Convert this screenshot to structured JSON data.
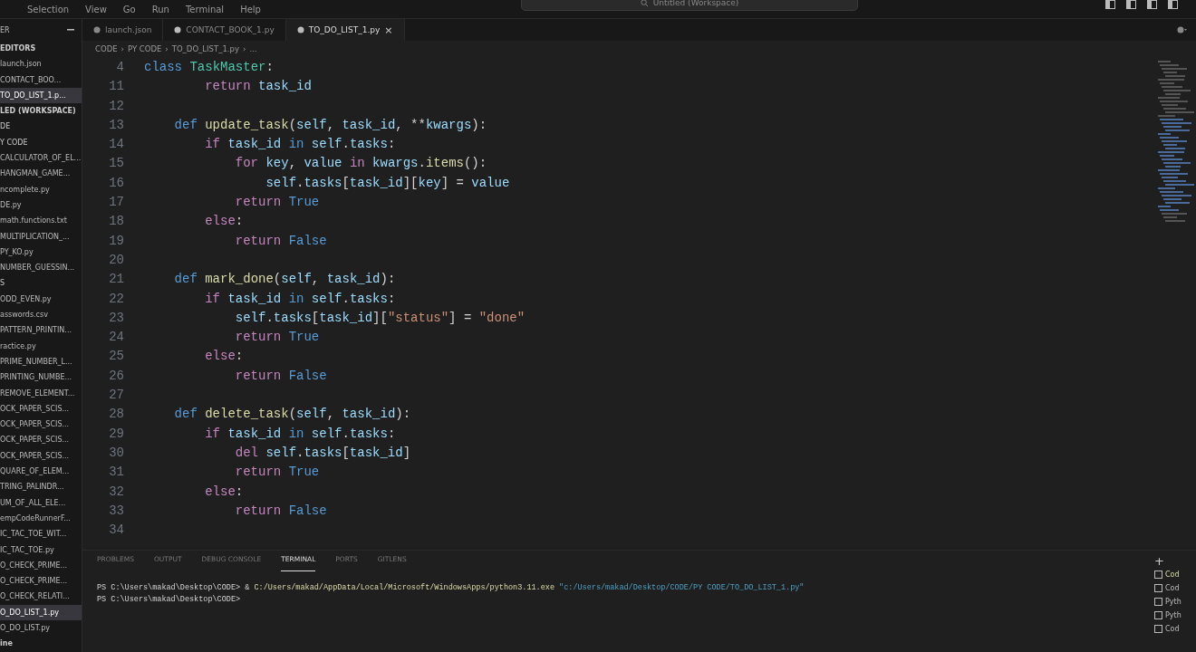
{
  "menu": [
    "Selection",
    "View",
    "Go",
    "Run",
    "Terminal",
    "Help"
  ],
  "command_center": {
    "text": "Untitled (Workspace)"
  },
  "sidebar": {
    "title": "ER",
    "items": [
      {
        "label": "EDITORS",
        "kind": "header",
        "selected": false
      },
      {
        "label": "launch.json",
        "kind": "file",
        "selected": false
      },
      {
        "label": "CONTACT_BOO...",
        "kind": "file",
        "selected": false
      },
      {
        "label": "TO_DO_LIST_1.p...",
        "kind": "file",
        "selected": true
      },
      {
        "label": "LED (WORKSPACE)",
        "kind": "header",
        "selected": false
      },
      {
        "label": "DE",
        "kind": "folder",
        "selected": false
      },
      {
        "label": "Y CODE",
        "kind": "folder",
        "selected": false
      },
      {
        "label": "CALCULATOR_OF_EL...",
        "kind": "file",
        "selected": false
      },
      {
        "label": "HANGMAN_GAME...",
        "kind": "file",
        "selected": false
      },
      {
        "label": "ncomplete.py",
        "kind": "file",
        "selected": false
      },
      {
        "label": "DE.py",
        "kind": "file",
        "selected": false
      },
      {
        "label": "math.functions.txt",
        "kind": "file",
        "selected": false
      },
      {
        "label": "MULTIPLICATION_...",
        "kind": "file",
        "selected": false
      },
      {
        "label": "PY_KO.py",
        "kind": "file",
        "selected": false
      },
      {
        "label": "NUMBER_GUESSIN...",
        "kind": "file",
        "selected": false
      },
      {
        "label": "S",
        "kind": "folder",
        "selected": false
      },
      {
        "label": "ODD_EVEN.py",
        "kind": "file",
        "selected": false
      },
      {
        "label": "asswords.csv",
        "kind": "file",
        "selected": false
      },
      {
        "label": "PATTERN_PRINTIN...",
        "kind": "file",
        "selected": false
      },
      {
        "label": "ractice.py",
        "kind": "file",
        "selected": false
      },
      {
        "label": "PRIME_NUMBER_L...",
        "kind": "file",
        "selected": false
      },
      {
        "label": "PRINTING_NUMBE...",
        "kind": "file",
        "selected": false
      },
      {
        "label": "REMOVE_ELEMENT...",
        "kind": "file",
        "selected": false
      },
      {
        "label": "OCK_PAPER_SCIS...",
        "kind": "file",
        "selected": false
      },
      {
        "label": "OCK_PAPER_SCIS...",
        "kind": "file",
        "selected": false
      },
      {
        "label": "OCK_PAPER_SCIS...",
        "kind": "file",
        "selected": false
      },
      {
        "label": "OCK_PAPER_SCIS...",
        "kind": "file",
        "selected": false
      },
      {
        "label": "QUARE_OF_ELEM...",
        "kind": "file",
        "selected": false
      },
      {
        "label": "TRING_PALINDR...",
        "kind": "file",
        "selected": false
      },
      {
        "label": "UM_OF_ALL_ELE...",
        "kind": "file",
        "selected": false
      },
      {
        "label": "empCodeRunnerF...",
        "kind": "file",
        "selected": false
      },
      {
        "label": "IC_TAC_TOE_WIT...",
        "kind": "file",
        "selected": false
      },
      {
        "label": "IC_TAC_TOE.py",
        "kind": "file",
        "selected": false
      },
      {
        "label": "O_CHECK_PRIME...",
        "kind": "file",
        "selected": false
      },
      {
        "label": "O_CHECK_PRIME...",
        "kind": "file",
        "selected": false
      },
      {
        "label": "O_CHECK_RELATI...",
        "kind": "file",
        "selected": false
      },
      {
        "label": "O_DO_LIST_1.py",
        "kind": "file",
        "selected": true
      },
      {
        "label": "O_DO_LIST.py",
        "kind": "file",
        "selected": false
      },
      {
        "label": "ine",
        "kind": "header",
        "selected": false
      }
    ]
  },
  "tabs": [
    {
      "label": "launch.json",
      "selected": false
    },
    {
      "label": "CONTACT_BOOK_1.py",
      "selected": false
    },
    {
      "label": "TO_DO_LIST_1.py",
      "selected": true
    }
  ],
  "tab_close": "×",
  "breadcrumb_separator": "›",
  "breadcrumb": [
    "CODE",
    "PY CODE",
    "TO_DO_LIST_1.py",
    "..."
  ],
  "code_lines": [
    {
      "number": "4",
      "tokens": [
        {
          "text": "class ",
          "kind": "keyword"
        },
        {
          "text": "TaskMaster",
          "kind": "type"
        },
        {
          "text": ":",
          "kind": "plain"
        }
      ]
    },
    {
      "number": "11",
      "tokens": [
        {
          "text": "        return ",
          "kind": "control"
        },
        {
          "text": "task_id",
          "kind": "variable"
        }
      ]
    },
    {
      "number": "12"
    },
    {
      "number": "13",
      "tokens": [
        {
          "text": "    def ",
          "kind": "keyword"
        },
        {
          "text": "update_task",
          "kind": "function"
        },
        {
          "text": "(",
          "kind": "plain"
        },
        {
          "text": "self",
          "kind": "variable"
        },
        {
          "text": ", ",
          "kind": "plain"
        },
        {
          "text": "task_id",
          "kind": "variable"
        },
        {
          "text": ", **",
          "kind": "plain"
        },
        {
          "text": "kwargs",
          "kind": "variable"
        },
        {
          "text": "):",
          "kind": "plain"
        }
      ]
    },
    {
      "number": "14",
      "tokens": [
        {
          "text": "        if ",
          "kind": "control"
        },
        {
          "text": "task_id ",
          "kind": "variable"
        },
        {
          "text": "in ",
          "kind": "keyword"
        },
        {
          "text": "self",
          "kind": "variable"
        },
        {
          "text": ".",
          "kind": "plain"
        },
        {
          "text": "tasks",
          "kind": "variable"
        },
        {
          "text": ":",
          "kind": "plain"
        }
      ]
    },
    {
      "number": "15",
      "tokens": [
        {
          "text": "            for ",
          "kind": "control"
        },
        {
          "text": "key",
          "kind": "variable"
        },
        {
          "text": ", ",
          "kind": "plain"
        },
        {
          "text": "value ",
          "kind": "variable"
        },
        {
          "text": "in ",
          "kind": "control"
        },
        {
          "text": "kwargs",
          "kind": "variable"
        },
        {
          "text": ".",
          "kind": "plain"
        },
        {
          "text": "items",
          "kind": "function"
        },
        {
          "text": "():",
          "kind": "plain"
        }
      ]
    },
    {
      "number": "16",
      "tokens": [
        {
          "text": "                self",
          "kind": "variable"
        },
        {
          "text": ".",
          "kind": "plain"
        },
        {
          "text": "tasks",
          "kind": "variable"
        },
        {
          "text": "[",
          "kind": "plain"
        },
        {
          "text": "task_id",
          "kind": "variable"
        },
        {
          "text": "][",
          "kind": "plain"
        },
        {
          "text": "key",
          "kind": "variable"
        },
        {
          "text": "] = ",
          "kind": "plain"
        },
        {
          "text": "value",
          "kind": "variable"
        }
      ]
    },
    {
      "number": "17",
      "tokens": [
        {
          "text": "            return ",
          "kind": "control"
        },
        {
          "text": "True",
          "kind": "keyword"
        }
      ]
    },
    {
      "number": "18",
      "tokens": [
        {
          "text": "        else",
          "kind": "control"
        },
        {
          "text": ":",
          "kind": "plain"
        }
      ]
    },
    {
      "number": "19",
      "tokens": [
        {
          "text": "            return ",
          "kind": "control"
        },
        {
          "text": "False",
          "kind": "keyword"
        }
      ]
    },
    {
      "number": "20"
    },
    {
      "number": "21",
      "tokens": [
        {
          "text": "    def ",
          "kind": "keyword"
        },
        {
          "text": "mark_done",
          "kind": "function"
        },
        {
          "text": "(",
          "kind": "plain"
        },
        {
          "text": "self",
          "kind": "variable"
        },
        {
          "text": ", ",
          "kind": "plain"
        },
        {
          "text": "task_id",
          "kind": "variable"
        },
        {
          "text": "):",
          "kind": "plain"
        }
      ]
    },
    {
      "number": "22",
      "tokens": [
        {
          "text": "        if ",
          "kind": "control"
        },
        {
          "text": "task_id ",
          "kind": "variable"
        },
        {
          "text": "in ",
          "kind": "keyword"
        },
        {
          "text": "self",
          "kind": "variable"
        },
        {
          "text": ".",
          "kind": "plain"
        },
        {
          "text": "tasks",
          "kind": "variable"
        },
        {
          "text": ":",
          "kind": "plain"
        }
      ]
    },
    {
      "number": "23",
      "tokens": [
        {
          "text": "            self",
          "kind": "variable"
        },
        {
          "text": ".",
          "kind": "plain"
        },
        {
          "text": "tasks",
          "kind": "variable"
        },
        {
          "text": "[",
          "kind": "plain"
        },
        {
          "text": "task_id",
          "kind": "variable"
        },
        {
          "text": "][",
          "kind": "plain"
        },
        {
          "text": "\"status\"",
          "kind": "string"
        },
        {
          "text": "] = ",
          "kind": "plain"
        },
        {
          "text": "\"done\"",
          "kind": "string"
        }
      ]
    },
    {
      "number": "24",
      "tokens": [
        {
          "text": "            return ",
          "kind": "control"
        },
        {
          "text": "True",
          "kind": "keyword"
        }
      ]
    },
    {
      "number": "25",
      "tokens": [
        {
          "text": "        else",
          "kind": "control"
        },
        {
          "text": ":",
          "kind": "plain"
        }
      ]
    },
    {
      "number": "26",
      "tokens": [
        {
          "text": "            return ",
          "kind": "control"
        },
        {
          "text": "False",
          "kind": "keyword"
        }
      ]
    },
    {
      "number": "27"
    },
    {
      "number": "28",
      "tokens": [
        {
          "text": "    def ",
          "kind": "keyword"
        },
        {
          "text": "delete_task",
          "kind": "function"
        },
        {
          "text": "(",
          "kind": "plain"
        },
        {
          "text": "self",
          "kind": "variable"
        },
        {
          "text": ", ",
          "kind": "plain"
        },
        {
          "text": "task_id",
          "kind": "variable"
        },
        {
          "text": "):",
          "kind": "plain"
        }
      ]
    },
    {
      "number": "29",
      "tokens": [
        {
          "text": "        if ",
          "kind": "control"
        },
        {
          "text": "task_id ",
          "kind": "variable"
        },
        {
          "text": "in ",
          "kind": "keyword"
        },
        {
          "text": "self",
          "kind": "variable"
        },
        {
          "text": ".",
          "kind": "plain"
        },
        {
          "text": "tasks",
          "kind": "variable"
        },
        {
          "text": ":",
          "kind": "plain"
        }
      ]
    },
    {
      "number": "30",
      "tokens": [
        {
          "text": "            del ",
          "kind": "control"
        },
        {
          "text": "self",
          "kind": "variable"
        },
        {
          "text": ".",
          "kind": "plain"
        },
        {
          "text": "tasks",
          "kind": "variable"
        },
        {
          "text": "[",
          "kind": "plain"
        },
        {
          "text": "task_id",
          "kind": "variable"
        },
        {
          "text": "]",
          "kind": "plain"
        }
      ]
    },
    {
      "number": "31",
      "tokens": [
        {
          "text": "            return ",
          "kind": "control"
        },
        {
          "text": "True",
          "kind": "keyword"
        }
      ]
    },
    {
      "number": "32",
      "tokens": [
        {
          "text": "        else",
          "kind": "control"
        },
        {
          "text": ":",
          "kind": "plain"
        }
      ]
    },
    {
      "number": "33",
      "tokens": [
        {
          "text": "            return ",
          "kind": "control"
        },
        {
          "text": "False",
          "kind": "keyword"
        }
      ]
    },
    {
      "number": "34"
    }
  ],
  "panel_tabs": [
    {
      "label": "PROBLEMS",
      "selected": false
    },
    {
      "label": "OUTPUT",
      "selected": false
    },
    {
      "label": "DEBUG CONSOLE",
      "selected": false
    },
    {
      "label": "TERMINAL",
      "selected": true
    },
    {
      "label": "PORTS",
      "selected": false
    },
    {
      "label": "GITLENS",
      "selected": false
    }
  ],
  "terminal_lines": [
    {
      "tokens": [
        {
          "text": "PS C:\\Users\\makad\\Desktop\\CODE> & ",
          "kind": "plain"
        },
        {
          "text": "C:/Users/makad/AppData/Local/Microsoft/WindowsApps/python3.11.exe",
          "kind": "function"
        },
        {
          "text": " \"c:/Users/makad/Desktop/CODE/PY CODE/TO_DO_LIST_1.py\"",
          "kind": "path"
        }
      ]
    },
    {
      "tokens": [
        {
          "text": "PS C:\\Users\\makad\\Desktop\\CODE>",
          "kind": "plain"
        }
      ]
    }
  ],
  "terminal_plus": "+",
  "terminal_list": [
    {
      "label": "Cod",
      "selected": true
    },
    {
      "label": "Cod",
      "selected": false
    },
    {
      "label": "Pyth",
      "selected": false
    },
    {
      "label": "Pyth",
      "selected": false
    },
    {
      "label": "Cod",
      "selected": false
    }
  ]
}
